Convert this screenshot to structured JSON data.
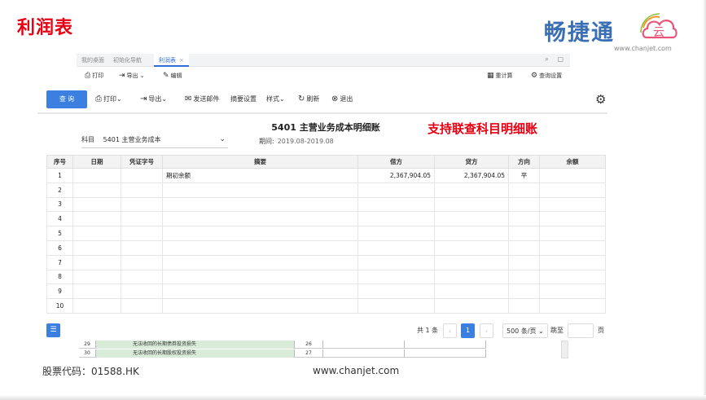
{
  "slide": {
    "title": "利润表",
    "callout": "支持联查科目明细账",
    "footer_stock": "股票代码：01588.HK",
    "footer_url": "www.chanjet.com"
  },
  "logo": {
    "name": "畅捷通",
    "url": "www.chanjet.com"
  },
  "app_tabs": {
    "items": [
      "我的桌面",
      "初始化导航",
      "利润表"
    ],
    "active": "利润表",
    "close_glyph": "×"
  },
  "toolbar1": {
    "print": "打印",
    "export": "导出",
    "edit": "编辑",
    "recalc": "重计算",
    "query_settings": "查询设置"
  },
  "toolbar2": {
    "query": "查 询",
    "print": "打印",
    "export": "导出",
    "send_mail": "发送邮件",
    "summary_settings": "摘要设置",
    "style": "样式",
    "refresh": "刷新",
    "exit": "退出"
  },
  "report": {
    "title": "5401 主营业务成本明细账",
    "subject_label": "科目",
    "subject_value": "5401 主营业务成本",
    "period_label": "期间:",
    "period_value": "2019.08-2019.08"
  },
  "table": {
    "headers": [
      "序号",
      "日期",
      "凭证字号",
      "摘要",
      "借方",
      "贷方",
      "方向",
      "余额"
    ],
    "rows": [
      [
        "1",
        "",
        "",
        "期初余额",
        "2,367,904.05",
        "2,367,904.05",
        "平",
        ""
      ],
      [
        "2",
        "",
        "",
        "",
        "",
        "",
        "",
        ""
      ],
      [
        "3",
        "",
        "",
        "",
        "",
        "",
        "",
        ""
      ],
      [
        "4",
        "",
        "",
        "",
        "",
        "",
        "",
        ""
      ],
      [
        "5",
        "",
        "",
        "",
        "",
        "",
        "",
        ""
      ],
      [
        "6",
        "",
        "",
        "",
        "",
        "",
        "",
        ""
      ],
      [
        "7",
        "",
        "",
        "",
        "",
        "",
        "",
        ""
      ],
      [
        "8",
        "",
        "",
        "",
        "",
        "",
        "",
        ""
      ],
      [
        "9",
        "",
        "",
        "",
        "",
        "",
        "",
        ""
      ],
      [
        "10",
        "",
        "",
        "",
        "",
        "",
        "",
        ""
      ]
    ]
  },
  "pager": {
    "total": "共 1 条",
    "prev": "‹",
    "current": "1",
    "next": "›",
    "page_size": "500 条/页",
    "goto_label": "跳至",
    "page_unit": "页"
  },
  "sheet_rows": [
    {
      "num": "29",
      "text": "无法收回的长期债券投资损失",
      "line": "26"
    },
    {
      "num": "30",
      "text": "无法收回的长期股权投资损失",
      "line": "27"
    }
  ],
  "colors": {
    "accent": "#3b7fe0",
    "title_red": "#e60012",
    "logo_blue": "#3a6fb5"
  }
}
